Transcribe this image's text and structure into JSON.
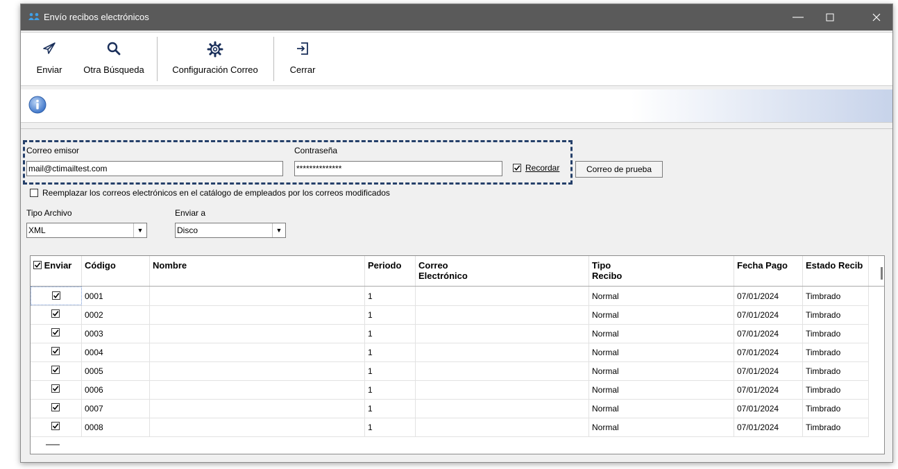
{
  "window": {
    "title": "Envío recibos electrónicos"
  },
  "toolbar": {
    "send_label": "Enviar",
    "search_label": "Otra Búsqueda",
    "config_label": "Configuración Correo",
    "close_label": "Cerrar"
  },
  "form": {
    "sender_label": "Correo emisor",
    "sender_value": "mail@ctimailtest.com",
    "password_label": "Contraseña",
    "password_value": "**************",
    "remember_label": "Recordar",
    "remember_checked": true,
    "test_button_label": "Correo de prueba",
    "replace_label": "Reemplazar los correos electrónicos en el catálogo de empleados por los correos modificados",
    "replace_checked": false,
    "file_type_label": "Tipo Archivo",
    "file_type_value": "XML",
    "send_to_label": "Enviar a",
    "send_to_value": "Disco"
  },
  "table": {
    "columns": [
      "Enviar",
      "Código",
      "Nombre",
      "Periodo",
      "Correo Electrónico",
      "Tipo Recibo",
      "Fecha Pago",
      "Estado Recib"
    ],
    "rows": [
      {
        "checked": true,
        "codigo": "0001",
        "nombre": "",
        "periodo": "1",
        "correo": "",
        "tipo": "Normal",
        "fecha": "07/01/2024",
        "estado": "Timbrado"
      },
      {
        "checked": true,
        "codigo": "0002",
        "nombre": "",
        "periodo": "1",
        "correo": "",
        "tipo": "Normal",
        "fecha": "07/01/2024",
        "estado": "Timbrado"
      },
      {
        "checked": true,
        "codigo": "0003",
        "nombre": "",
        "periodo": "1",
        "correo": "",
        "tipo": "Normal",
        "fecha": "07/01/2024",
        "estado": "Timbrado"
      },
      {
        "checked": true,
        "codigo": "0004",
        "nombre": "",
        "periodo": "1",
        "correo": "",
        "tipo": "Normal",
        "fecha": "07/01/2024",
        "estado": "Timbrado"
      },
      {
        "checked": true,
        "codigo": "0005",
        "nombre": "",
        "periodo": "1",
        "correo": "",
        "tipo": "Normal",
        "fecha": "07/01/2024",
        "estado": "Timbrado"
      },
      {
        "checked": true,
        "codigo": "0006",
        "nombre": "",
        "periodo": "1",
        "correo": "",
        "tipo": "Normal",
        "fecha": "07/01/2024",
        "estado": "Timbrado"
      },
      {
        "checked": true,
        "codigo": "0007",
        "nombre": "",
        "periodo": "1",
        "correo": "",
        "tipo": "Normal",
        "fecha": "07/01/2024",
        "estado": "Timbrado"
      },
      {
        "checked": true,
        "codigo": "0008",
        "nombre": "",
        "periodo": "1",
        "correo": "",
        "tipo": "Normal",
        "fecha": "07/01/2024",
        "estado": "Timbrado"
      }
    ]
  },
  "colors": {
    "titlebar": "#5a5a5a",
    "highlight_border": "#25406a",
    "info_blue": "#4a7fd0"
  }
}
